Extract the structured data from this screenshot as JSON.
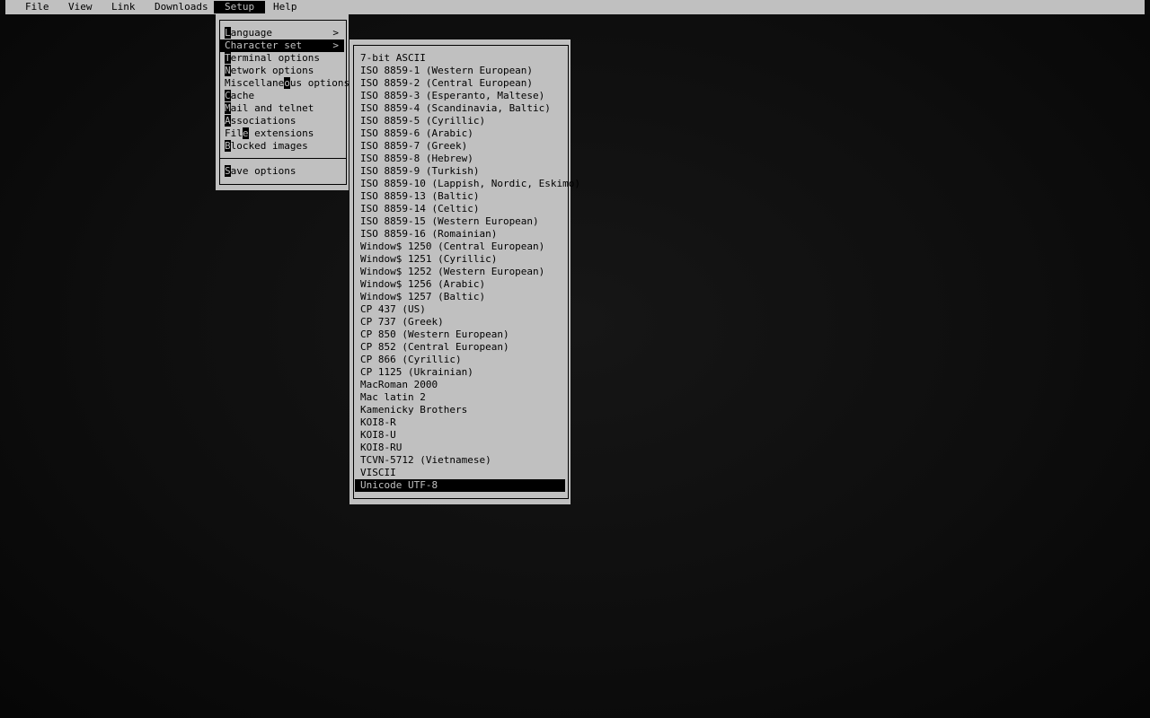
{
  "menubar": {
    "items": [
      {
        "label": "File"
      },
      {
        "label": "View"
      },
      {
        "label": "Link"
      },
      {
        "label": "Downloads"
      },
      {
        "label": "Setup"
      },
      {
        "label": "Help"
      }
    ],
    "active": "Setup"
  },
  "setup_menu": {
    "items": [
      {
        "hot": "L",
        "rest": "anguage",
        "arrow": ">"
      },
      {
        "hot": "C",
        "rest": "haracter set",
        "arrow": ">"
      },
      {
        "hot": "T",
        "rest": "erminal options",
        "arrow": ""
      },
      {
        "hot": "N",
        "rest": "etwork options",
        "arrow": ""
      },
      {
        "pre": "Miscellane",
        "hot": "o",
        "rest": "us options",
        "arrow": ""
      },
      {
        "hot": "C",
        "rest": "ache",
        "arrow": ""
      },
      {
        "hot": "M",
        "rest": "ail and telnet",
        "arrow": ""
      },
      {
        "hot": "A",
        "rest": "ssociations",
        "arrow": ""
      },
      {
        "pre": "Fil",
        "hot": "e",
        "rest": " extensions",
        "arrow": ""
      },
      {
        "hot": "B",
        "rest": "locked images",
        "arrow": ""
      }
    ],
    "save": {
      "hot": "S",
      "rest": "ave options"
    },
    "selected_index": 1
  },
  "charset_menu": {
    "items": [
      "7-bit ASCII",
      "ISO 8859-1 (Western European)",
      "ISO 8859-2 (Central European)",
      "ISO 8859-3 (Esperanto, Maltese)",
      "ISO 8859-4 (Scandinavia, Baltic)",
      "ISO 8859-5 (Cyrillic)",
      "ISO 8859-6 (Arabic)",
      "ISO 8859-7 (Greek)",
      "ISO 8859-8 (Hebrew)",
      "ISO 8859-9 (Turkish)",
      "ISO 8859-10 (Lappish, Nordic, Eskimo)",
      "ISO 8859-13 (Baltic)",
      "ISO 8859-14 (Celtic)",
      "ISO 8859-15 (Western European)",
      "ISO 8859-16 (Romainian)",
      "Window$ 1250 (Central European)",
      "Window$ 1251 (Cyrillic)",
      "Window$ 1252 (Western European)",
      "Window$ 1256 (Arabic)",
      "Window$ 1257 (Baltic)",
      "CP 437 (US)",
      "CP 737 (Greek)",
      "CP 850 (Western European)",
      "CP 852 (Central European)",
      "CP 866 (Cyrillic)",
      "CP 1125 (Ukrainian)",
      "MacRoman 2000",
      "Mac latin 2",
      "Kamenicky Brothers",
      "KOI8-R",
      "KOI8-U",
      "KOI8-RU",
      "TCVN-5712 (Vietnamese)",
      "VISCII",
      "Unicode UTF-8"
    ],
    "selected_index": 34
  },
  "colors": {
    "menu_bg": "#c0c0c0",
    "menu_fg": "#000000",
    "highlight_bg": "#000000",
    "highlight_fg": "#c0c0c0"
  }
}
